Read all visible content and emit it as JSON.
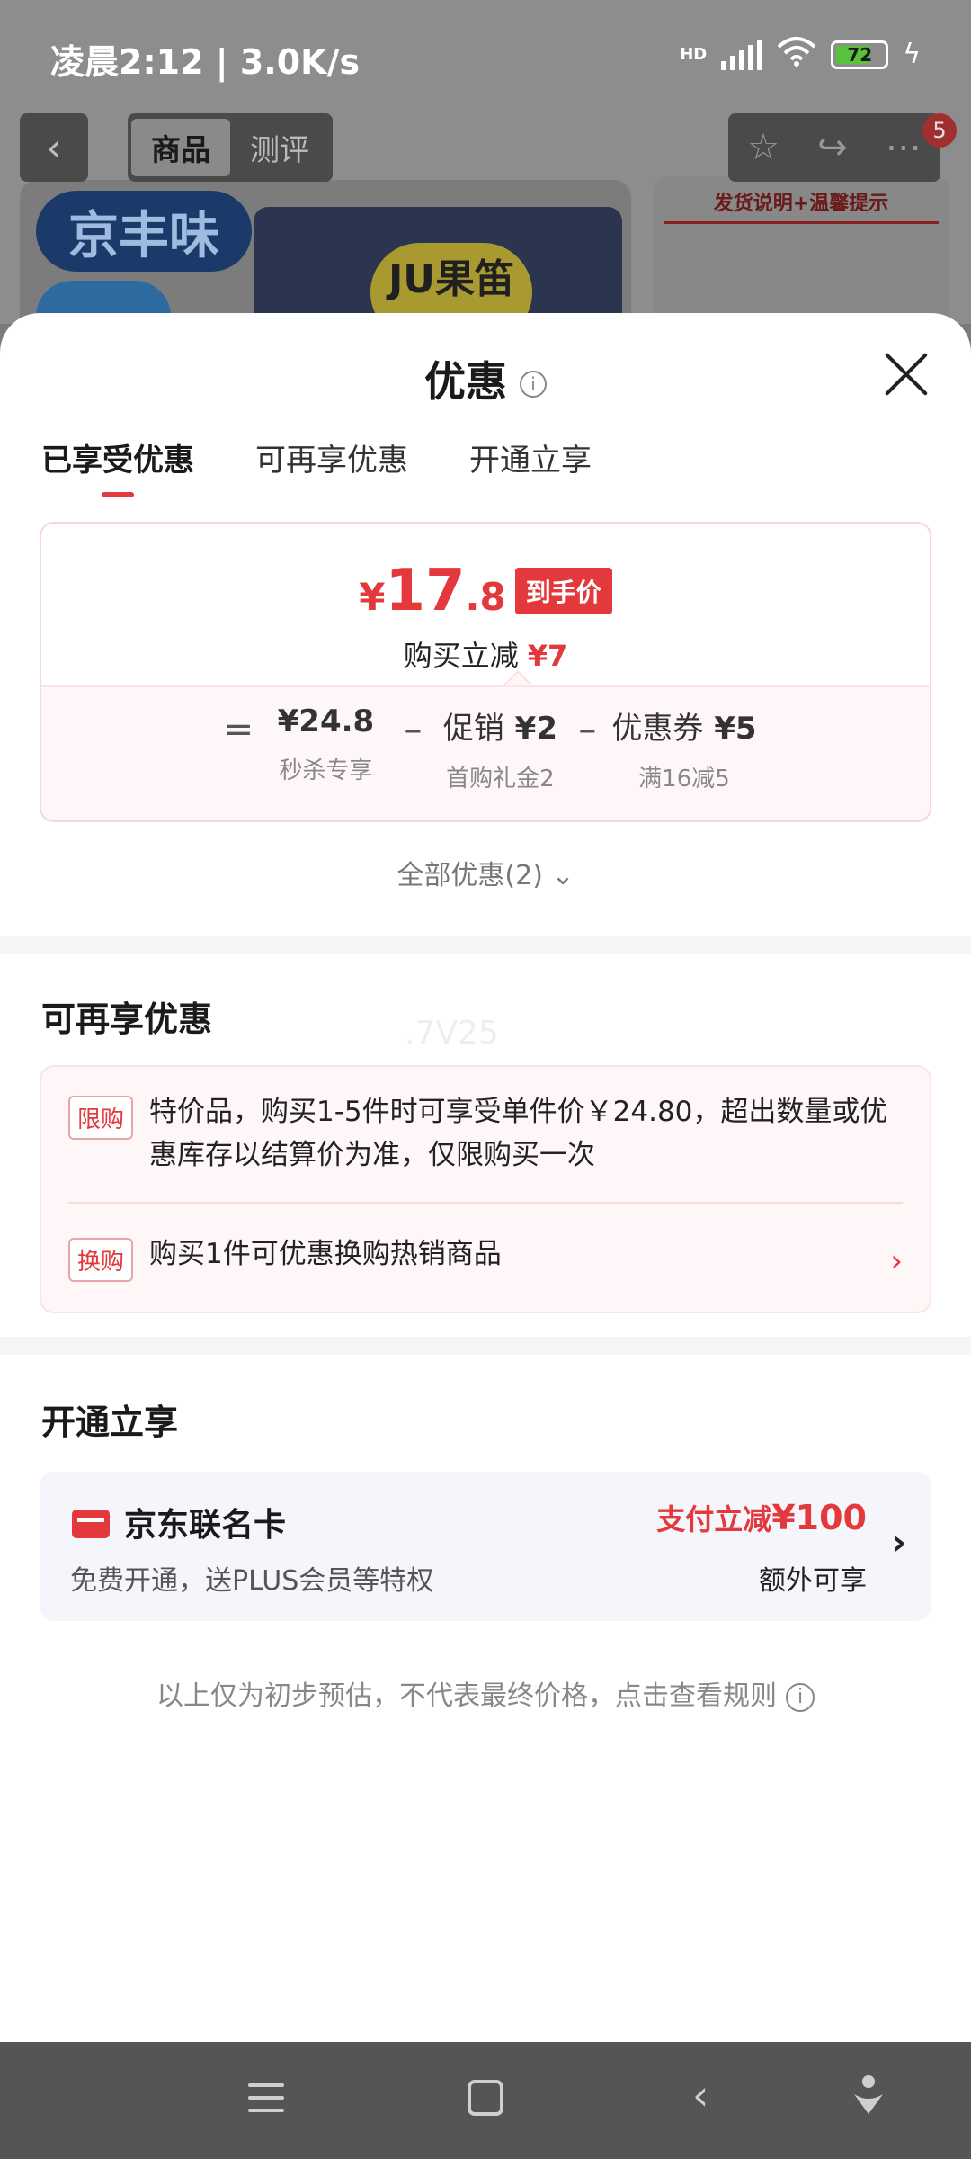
{
  "status_bar": {
    "time_speed": "凌晨2:12 | 3.0K/s",
    "network": "HD",
    "battery": "72"
  },
  "product_header": {
    "tabs": [
      "商品",
      "测评"
    ],
    "badge_count": "5",
    "brand_text": "京丰味",
    "label_text": "JU果笛",
    "notice_title": "发货说明+温馨提示"
  },
  "sheet": {
    "title": "优惠",
    "tabs": [
      "已享受优惠",
      "可再享优惠",
      "开通立享"
    ],
    "final_price": {
      "currency": "¥",
      "integer": "17",
      "decimal": ".8",
      "tag": "到手价"
    },
    "instant_cut": {
      "label": "购买立减",
      "amount": "¥7"
    },
    "formula": {
      "equals": "=",
      "minus": "–",
      "terms": [
        {
          "label": "",
          "value": "¥24.8",
          "sub": "秒杀专享"
        },
        {
          "label": "促销",
          "value": "¥2",
          "sub": "首购礼金2"
        },
        {
          "label": "优惠券",
          "value": "¥5",
          "sub": "满16减5"
        }
      ]
    },
    "all_discounts": "全部优惠(2)",
    "more_section": {
      "title": "可再享优惠",
      "watermark": ".7V25",
      "items": [
        {
          "tag": "限购",
          "text": "特价品，购买1-5件时可享受单件价￥24.80，超出数量或优惠库存以结算价为准，仅限购买一次"
        },
        {
          "tag": "换购",
          "text": "购买1件可优惠换购热销商品"
        }
      ]
    },
    "open_section": {
      "title": "开通立享",
      "card_name": "京东联名卡",
      "card_desc": "免费开通，送PLUS会员等特权",
      "offer_label": "支付立减",
      "offer_amount": "¥100",
      "extra": "额外可享"
    },
    "disclaimer": "以上仅为初步预估，不代表最终价格，点击查看规则"
  },
  "colors": {
    "accent": "#e4393c",
    "divider": "#f4f5f7",
    "promo_bg": "#fff6f7"
  },
  "icons": [
    "back-icon",
    "star-icon",
    "share-icon",
    "more-icon",
    "info-icon",
    "close-icon",
    "chevron-down-icon",
    "chevron-right-icon",
    "card-icon",
    "menu-icon",
    "home-icon",
    "nav-back-icon",
    "assistant-icon"
  ]
}
